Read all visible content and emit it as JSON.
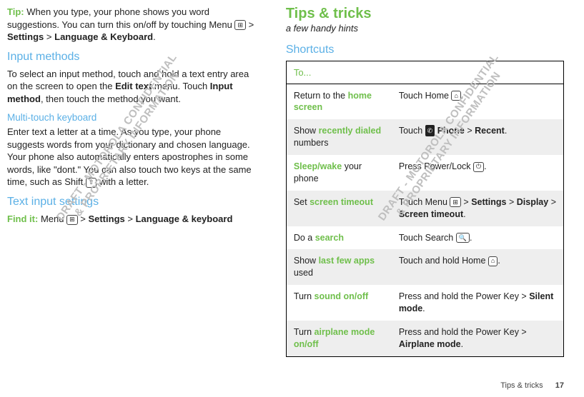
{
  "left": {
    "tip_label": "Tip:",
    "tip_text": "When you type, your phone shows you word suggestions. You can turn this on/off by touching Menu ",
    "tip_tail1": " > ",
    "tip_bold1": "Settings",
    "tip_tail2": " > ",
    "tip_bold2": "Language & Keyboard",
    "tip_period": ".",
    "input_h": "Input methods",
    "input_p1a": "To select an input method, touch and hold a text entry area on the screen to open the ",
    "input_p1b": "Edit text",
    "input_p1c": " menu. Touch ",
    "input_p1d": "Input method",
    "input_p1e": ", then touch the method you want.",
    "multi_h": "Multi-touch keyboard",
    "multi_p": "Enter text a letter at a time. As you type, your phone suggests words from your dictionary and chosen language. Your phone also automatically enters apostrophes in some words, like \"dont.\" You can also touch two keys at the same time, such as Shift ",
    "multi_tail": " with a letter.",
    "tis_h": "Text input settings",
    "find_label": "Find it:",
    "find_a": " Menu ",
    "find_b": " > ",
    "find_bold1": "Settings",
    "find_c": " > ",
    "find_bold2": "Language & keyboard"
  },
  "right": {
    "title": "Tips & tricks",
    "sub": "a few handy hints",
    "shortcuts_h": "Shortcuts",
    "to": "To...",
    "rows": [
      {
        "k_pre": "Return to the ",
        "k_kw": "home screen",
        "k_post": "",
        "v_pre": "Touch Home ",
        "v_icon": "⌂",
        "v_mid": "",
        "v_bold1": "",
        "v_sep": "",
        "v_bold2": "",
        "v_post": "."
      },
      {
        "k_pre": "Show ",
        "k_kw": "recently dialed",
        "k_post": " numbers",
        "v_pre": "Touch ",
        "v_icon_dark": "✆",
        "v_mid": " ",
        "v_bold1": "Phone",
        "v_sep": " > ",
        "v_bold2": "Recent",
        "v_post": "."
      },
      {
        "k_pre": "",
        "k_kw": "Sleep/wake",
        "k_post": " your phone",
        "v_pre": "Press Power/Lock ",
        "v_icon": "⏻",
        "v_post": "."
      },
      {
        "k_pre": "Set ",
        "k_kw": "screen timeout",
        "k_post": "",
        "v_pre": "Touch Menu ",
        "v_icon": "⊞",
        "v_mid": " > ",
        "v_bold1": "Settings",
        "v_sep": " > ",
        "v_bold2": "Display",
        "v_sep2": " > ",
        "v_bold3": "Screen timeout",
        "v_post": "."
      },
      {
        "k_pre": "Do a ",
        "k_kw": "search",
        "k_post": "",
        "v_pre": "Touch Search ",
        "v_icon": "🔍",
        "v_post": "."
      },
      {
        "k_pre": "Show ",
        "k_kw": "last few apps",
        "k_post": " used",
        "v_pre": "Touch and hold Home ",
        "v_icon": "⌂",
        "v_post": "."
      },
      {
        "k_pre": "Turn ",
        "k_kw": "sound on/off",
        "k_post": "",
        "v_pre": "Press and hold the Power Key > ",
        "v_bold1": "Silent mode",
        "v_post": "."
      },
      {
        "k_pre": "Turn ",
        "k_kw": "airplane mode on/off",
        "k_post": "",
        "v_pre": "Press and hold the Power Key > ",
        "v_bold1": "Airplane mode",
        "v_post": "."
      }
    ]
  },
  "footer": {
    "section": "Tips & tricks",
    "page": "17"
  },
  "watermark": "DRAFT - MOTOROLA CONFIDENTIAL\n& PROPRIETARY INFORMATION",
  "icons": {
    "menu": "⊞",
    "shift": "⇧"
  }
}
